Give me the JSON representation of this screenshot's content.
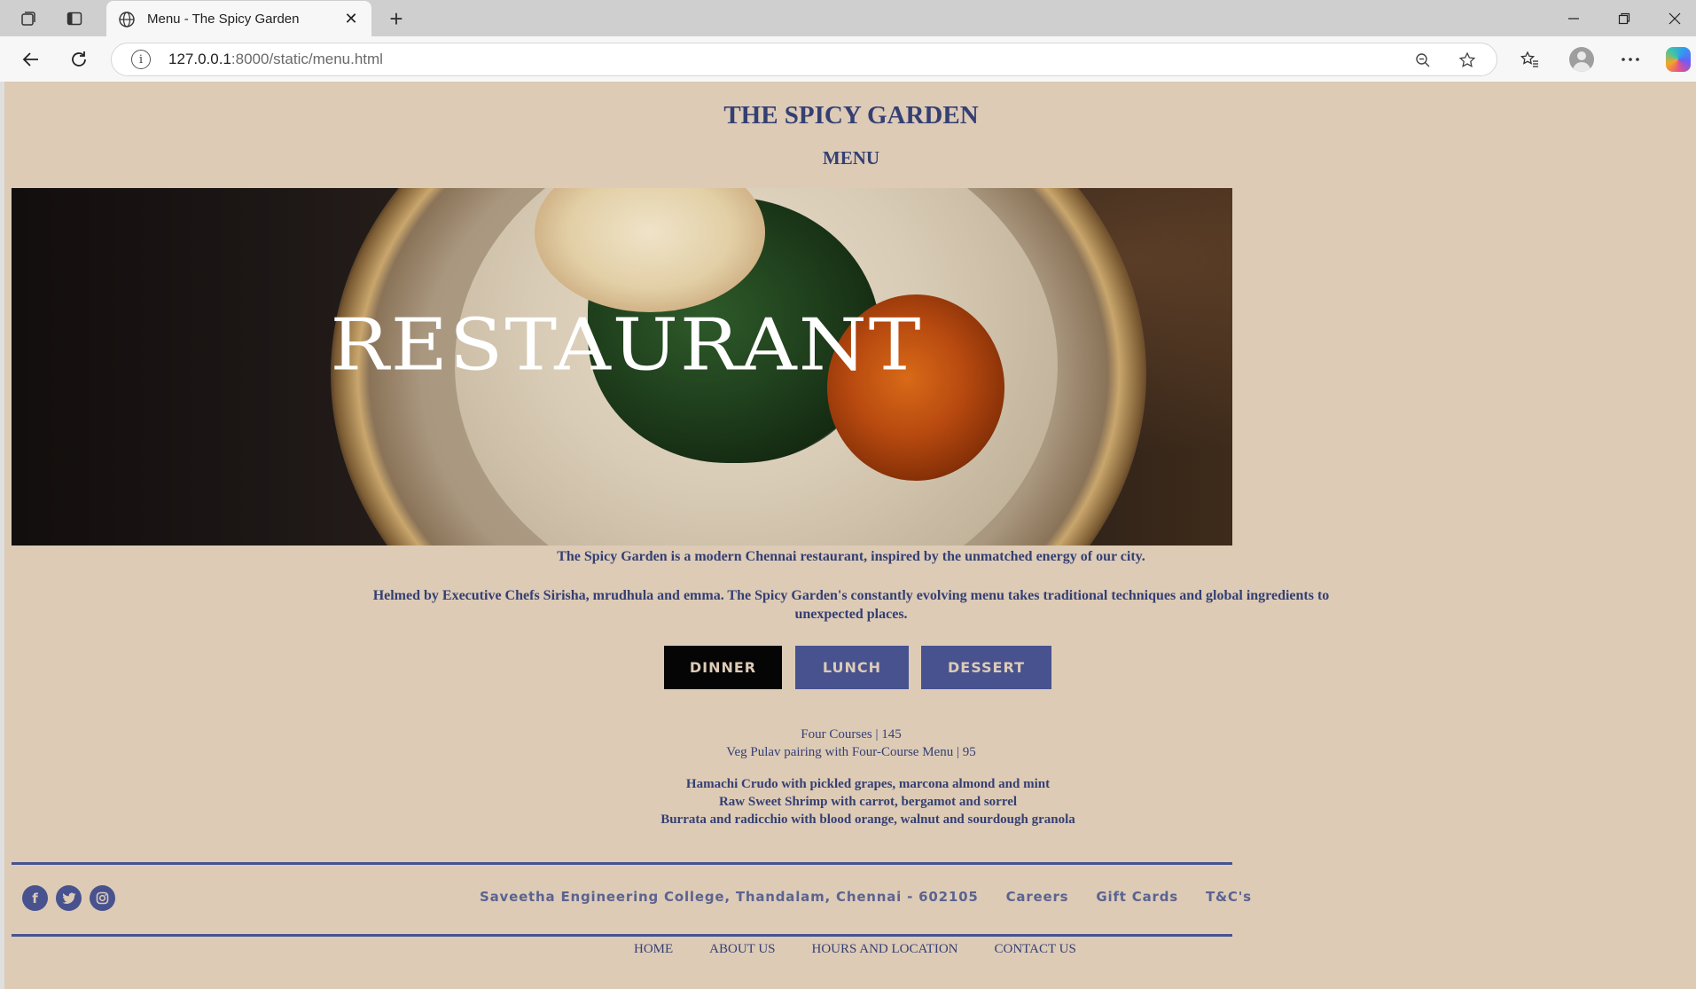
{
  "browser": {
    "tab_title": "Menu - The Spicy Garden",
    "url_host": "127.0.0.1",
    "url_rest": ":8000/static/menu.html",
    "new_tab_symbol": "+",
    "close_symbol": "✕"
  },
  "page": {
    "site_title": "THE SPICY GARDEN",
    "subtitle": "MENU",
    "hero_text": "RESTAURANT",
    "tagline": "The Spicy Garden is a modern Chennai restaurant, inspired by the unmatched energy of our city.",
    "about": "Helmed by Executive Chefs Sirisha, mrudhula and emma. The Spicy Garden's constantly evolving menu takes traditional techniques and global ingredients to unexpected places.",
    "menu_tabs": {
      "dinner": "DINNER",
      "lunch": "LUNCH",
      "dessert": "DESSERT"
    },
    "courses": [
      "Four Courses | 145",
      "Veg Pulav pairing with Four-Course Menu | 95"
    ],
    "dishes": [
      "Hamachi Crudo with pickled grapes, marcona almond and mint",
      "Raw Sweet Shrimp with carrot, bergamot and sorrel",
      "Burrata and radicchio with blood orange, walnut and sourdough granola"
    ]
  },
  "footer": {
    "social_icons": [
      "facebook-icon",
      "twitter-icon",
      "instagram-icon"
    ],
    "address": "Saveetha Engineering College, Thandalam, Chennai - 602105",
    "careers": "Careers",
    "gift_cards": "Gift Cards",
    "terms": "T&C's",
    "nav": {
      "home": "HOME",
      "about": "ABOUT US",
      "hours": "HOURS AND LOCATION",
      "contact": "CONTACT US"
    }
  },
  "colors": {
    "page_bg": "#ddcbb6",
    "primary_text": "#343f73",
    "button_active": "#050505",
    "button": "#47528f"
  }
}
